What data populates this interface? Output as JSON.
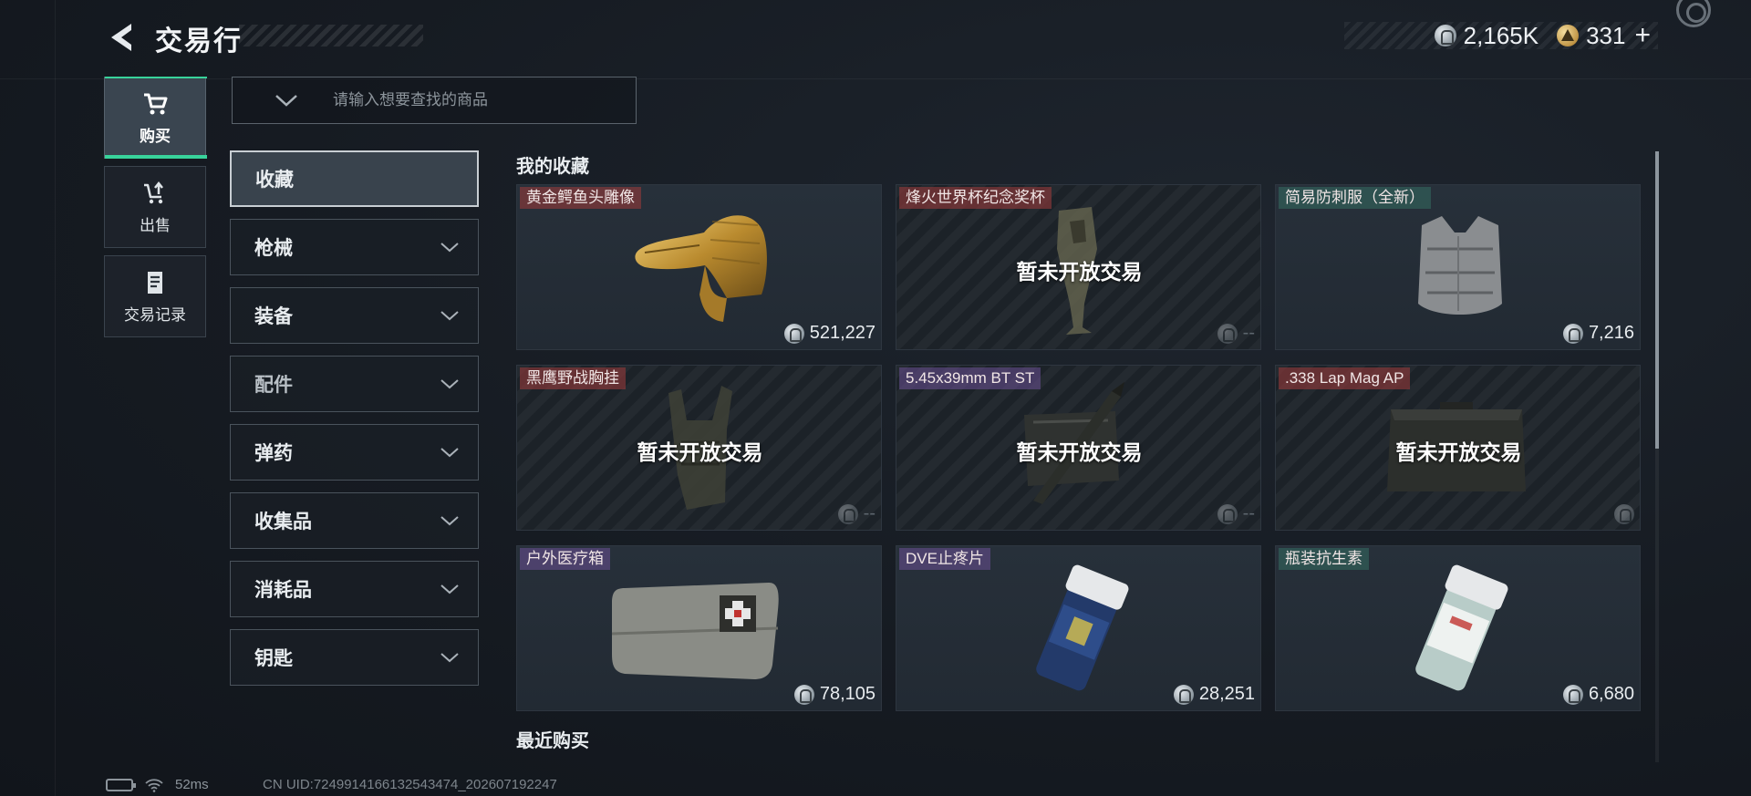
{
  "header": {
    "title": "交易行",
    "currency_silver": "2,165K",
    "currency_gold": "331"
  },
  "nav": [
    {
      "label": "购买",
      "icon": "cart-icon",
      "active": true
    },
    {
      "label": "出售",
      "icon": "sell-icon",
      "active": false
    },
    {
      "label": "交易记录",
      "icon": "record-icon",
      "active": false
    }
  ],
  "search": {
    "placeholder": "请输入想要查找的商品"
  },
  "categories": [
    {
      "label": "收藏"
    },
    {
      "label": "枪械"
    },
    {
      "label": "装备"
    },
    {
      "label": "配件"
    },
    {
      "label": "弹药"
    },
    {
      "label": "收集品"
    },
    {
      "label": "消耗品"
    },
    {
      "label": "钥匙"
    }
  ],
  "sections": {
    "favorites": "我的收藏",
    "recent": "最近购买"
  },
  "locked_label": "暂未开放交易",
  "items": [
    {
      "name": "黄金鳄鱼头雕像",
      "price": "521,227",
      "icon": "gold-crocodile-statue-icon",
      "tag_color": "#963a3a"
    },
    {
      "name": "烽火世界杯纪念奖杯",
      "price": "--",
      "icon": "trophy-icon",
      "tag_color": "#963a3a"
    },
    {
      "name": "简易防刺服（全新）",
      "price": "7,216",
      "icon": "vest-icon",
      "tag_color": "#346e62"
    },
    {
      "name": "黑鹰野战胸挂",
      "price": "--",
      "icon": "chest-rig-icon",
      "tag_color": "#963a3a"
    },
    {
      "name": "5.45x39mm BT ST",
      "price": "--",
      "icon": "ammo-icon",
      "tag_color": "#6c5096"
    },
    {
      "name": ".338 Lap Mag AP",
      "price": "--",
      "icon": "ammo-box-icon",
      "tag_color": "#963a3a"
    },
    {
      "name": "户外医疗箱",
      "price": "78,105",
      "icon": "medkit-icon",
      "tag_color": "#6c5096"
    },
    {
      "name": "DVE止疼片",
      "price": "28,251",
      "icon": "pill-bottle-icon",
      "tag_color": "#6c5096"
    },
    {
      "name": "瓶装抗生素",
      "price": "6,680",
      "icon": "antibiotic-bottle-icon",
      "tag_color": "#346e62"
    }
  ],
  "status": {
    "ping": "52ms",
    "uid": "CN UID:7249914166132543474_202607192247"
  }
}
